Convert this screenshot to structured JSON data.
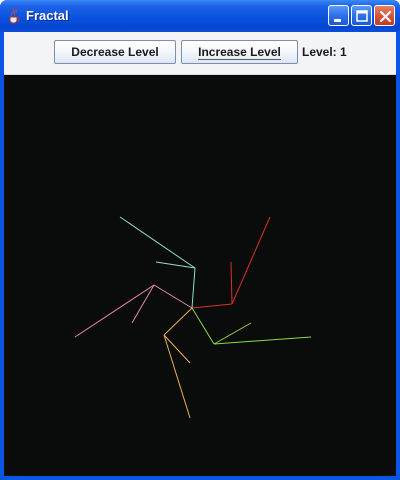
{
  "window": {
    "title": "Fractal",
    "icon": "java-cup-icon",
    "controls": [
      "minimize-icon",
      "maximize-icon",
      "close-icon"
    ]
  },
  "toolbar": {
    "decrease_label": "Decrease Level",
    "increase_label": "Increase Level",
    "level_label": "Level: 1"
  },
  "canvas": {
    "background": "#0a0c0c",
    "fractal_colors": [
      "#d8302a",
      "#8ed84a",
      "#e8b24a",
      "#e58aa0",
      "#8fe0c8"
    ]
  }
}
